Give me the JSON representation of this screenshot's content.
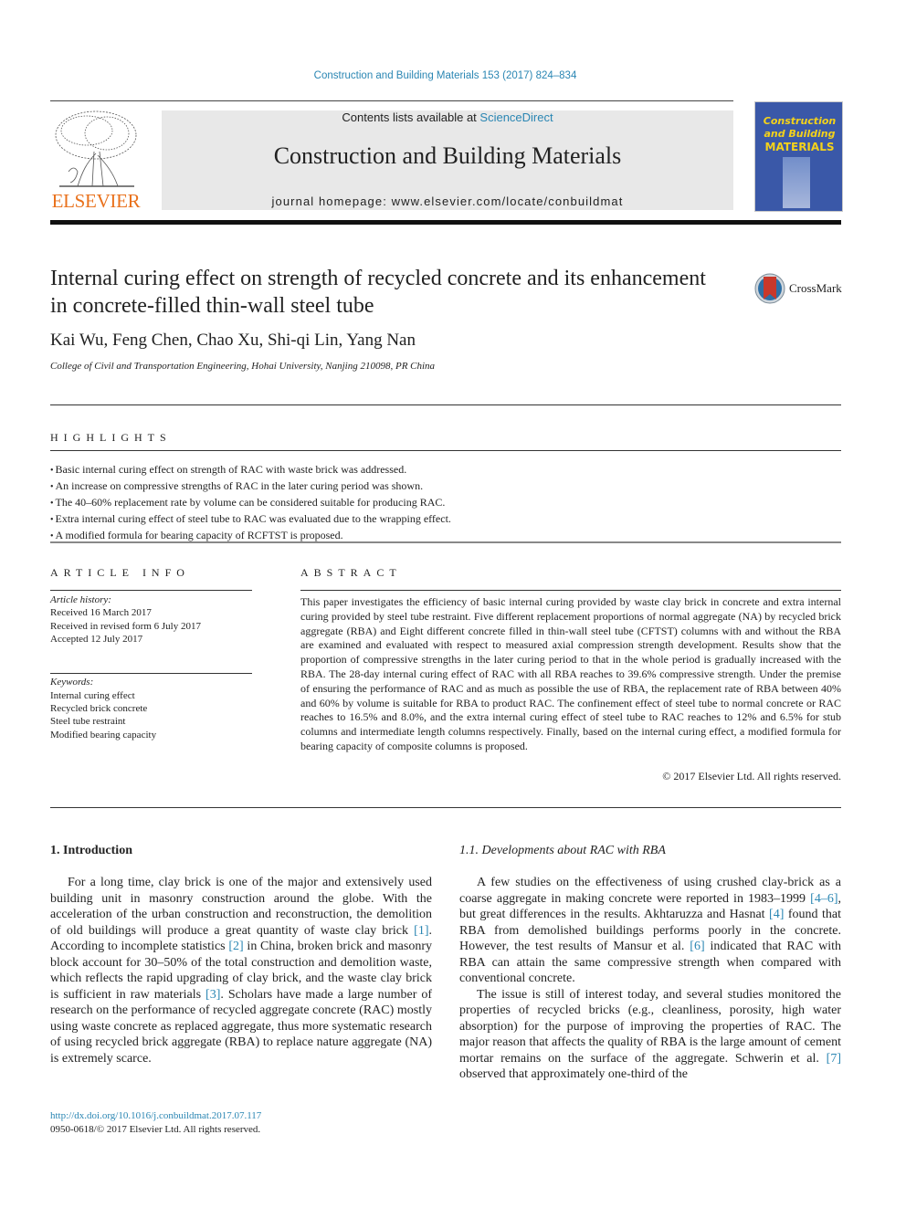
{
  "header": {
    "citation": "Construction and Building Materials 153 (2017) 824–834",
    "contents_prefix": "Contents lists available at ",
    "contents_link": "ScienceDirect",
    "journal_name": "Construction and Building Materials",
    "homepage": "journal homepage: www.elsevier.com/locate/conbuildmat",
    "publisher_logo_text": "ELSEVIER",
    "cover": {
      "line1": "Construction",
      "line2": "and Building",
      "line3": "MATERIALS"
    }
  },
  "article": {
    "title": "Internal curing effect on strength of recycled concrete and its enhancement in concrete-filled thin-wall steel tube",
    "crossmark_label": "CrossMark",
    "authors": "Kai Wu, Feng Chen, Chao Xu, Shi-qi Lin, Yang Nan",
    "affiliation": "College of Civil and Transportation Engineering, Hohai University, Nanjing 210098, PR China"
  },
  "highlights": {
    "label": "HIGHLIGHTS",
    "items": [
      "Basic internal curing effect on strength of RAC with waste brick was addressed.",
      "An increase on compressive strengths of RAC in the later curing period was shown.",
      "The 40–60% replacement rate by volume can be considered suitable for producing RAC.",
      "Extra internal curing effect of steel tube to RAC was evaluated due to the wrapping effect.",
      "A modified formula for bearing capacity of RCFTST is proposed."
    ]
  },
  "article_info": {
    "label": "ARTICLE INFO",
    "history_label": "Article history:",
    "history": [
      "Received 16 March 2017",
      "Received in revised form 6 July 2017",
      "Accepted 12 July 2017"
    ],
    "keywords_label": "Keywords:",
    "keywords": [
      "Internal curing effect",
      "Recycled brick concrete",
      "Steel tube restraint",
      "Modified bearing capacity"
    ]
  },
  "abstract": {
    "label": "ABSTRACT",
    "text": "This paper investigates the efficiency of basic internal curing provided by waste clay brick in concrete and extra internal curing provided by steel tube restraint. Five different replacement proportions of normal aggregate (NA) by recycled brick aggregate (RBA) and Eight different concrete filled in thin-wall steel tube (CFTST) columns with and without the RBA are examined and evaluated with respect to measured axial compression strength development. Results show that the proportion of compressive strengths in the later curing period to that in the whole period is gradually increased with the RBA. The 28-day internal curing effect of RAC with all RBA reaches to 39.6% compressive strength. Under the premise of ensuring the performance of RAC and as much as possible the use of RBA, the replacement rate of RBA between 40% and 60% by volume is suitable for RBA to product RAC. The confinement effect of steel tube to normal concrete or RAC reaches to 16.5% and 8.0%, and the extra internal curing effect of steel tube to RAC reaches to 12% and 6.5% for stub columns and intermediate length columns respectively. Finally, based on the internal curing effect, a modified formula for bearing capacity of composite columns is proposed.",
    "copyright": "© 2017 Elsevier Ltd. All rights reserved."
  },
  "body": {
    "intro_heading": "1. Introduction",
    "intro": {
      "t1": "For a long time, clay brick is one of the major and extensively used building unit in masonry construction around the globe. With the acceleration of the urban construction and reconstruction, the demolition of old buildings will produce a great quantity of waste clay brick ",
      "r1": "[1]",
      "t2": ". According to incomplete statistics ",
      "r2": "[2]",
      "t3": " in China, broken brick and masonry block account for 30–50% of the total construction and demolition waste, which reflects the rapid upgrading of clay brick, and the waste clay brick is sufficient in raw materials ",
      "r3": "[3]",
      "t4": ". Scholars have made a large number of research on the performance of recycled aggregate concrete (RAC) mostly using waste concrete as replaced aggregate, thus more systematic research of using recycled brick aggregate (RBA) to replace nature aggregate (NA) is extremely scarce."
    },
    "subsection_heading": "1.1. Developments about RAC with RBA",
    "sub_p1": {
      "t1": "A few studies on the effectiveness of using crushed clay-brick as a coarse aggregate in making concrete were reported in 1983–1999 ",
      "r1": "[4–6]",
      "t2": ", but great differences in the results. Akhtaruzza and Hasnat ",
      "r2": "[4]",
      "t3": " found that RBA from demolished buildings performs poorly in the concrete. However, the test results of Mansur et al. ",
      "r3": "[6]",
      "t4": " indicated that RAC with RBA can attain the same compressive strength when compared with conventional concrete."
    },
    "sub_p2": {
      "t1": "The issue is still of interest today, and several studies monitored the properties of recycled bricks (e.g., cleanliness, porosity, high water absorption) for the purpose of improving the properties of RAC. The major reason that affects the quality of RBA is the large amount of cement mortar remains on the surface of the aggregate. Schwerin et al. ",
      "r1": "[7]",
      "t2": " observed that approximately one-third of the"
    }
  },
  "footer": {
    "doi": "http://dx.doi.org/10.1016/j.conbuildmat.2017.07.117",
    "issn": "0950-0618/© 2017 Elsevier Ltd. All rights reserved."
  }
}
